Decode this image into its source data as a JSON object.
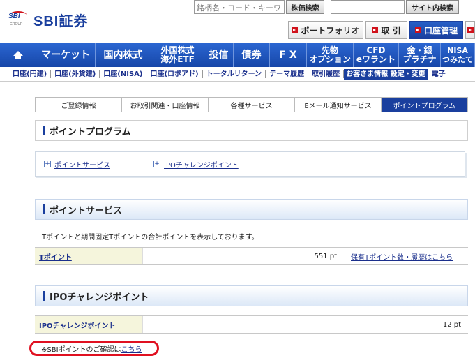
{
  "header": {
    "logo_small": "SBI",
    "logo_group": "GROUP",
    "logo_text": "SBI証券",
    "stock_search_placeholder": "銘柄名・コード・キーワ",
    "stock_search_button": "株価検索",
    "site_search_placeholder": "",
    "site_search_button": "サイト内検索",
    "portfolio": "ポートフォリオ",
    "trade": "取 引",
    "account": "口座管理",
    "extra": "ロ"
  },
  "mainnav": [
    "マーケット",
    "国内株式",
    "外国株式\n海外ETF",
    "投信",
    "債券",
    "F X",
    "先物\nオプション",
    "CFD\neワラント",
    "金・銀\nプラチナ",
    "NISA\nつみたて"
  ],
  "subnav": [
    "口座(円建)",
    "口座(外貨建)",
    "口座(NISA)",
    "口座(ロボアド)",
    "トータルリターン",
    "テーマ履歴",
    "取引履歴",
    "お客さま情報 設定・変更",
    "電子"
  ],
  "subnav_active_index": 7,
  "tabs": [
    "ご登録情報",
    "お取引関連・口座情報",
    "各種サービス",
    "Eメール通知サービス",
    "ポイントプログラム"
  ],
  "tabs_active_index": 4,
  "page_title": "ポイントプログラム",
  "quick_links": [
    "ポイントサービス",
    "IPOチャレンジポイント"
  ],
  "point_service": {
    "title": "ポイントサービス",
    "description": "Tポイントと期間固定Tポイントの合計ポイントを表示しております。",
    "row_label": "Tポイント",
    "row_value": "551 pt",
    "row_link": "保有Tポイント数・履歴はこちら"
  },
  "ipo": {
    "title": "IPOチャレンジポイント",
    "row_label": "IPOチャレンジポイント",
    "row_value": "12 pt"
  },
  "note": {
    "prefix": "※SBIポイントのご確認は",
    "link": "こちら"
  }
}
